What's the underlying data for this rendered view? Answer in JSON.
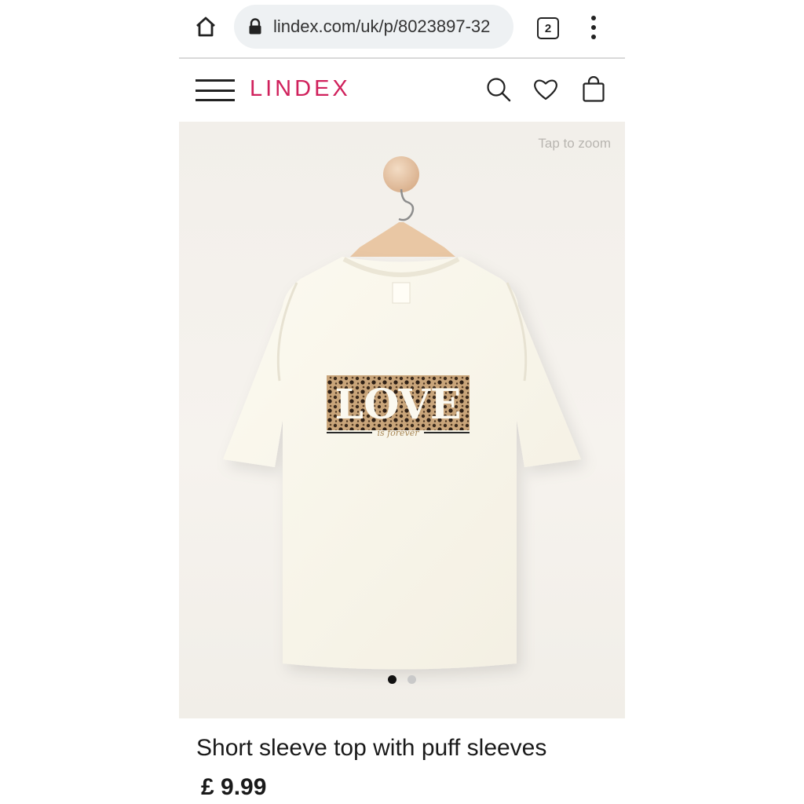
{
  "browser": {
    "url": "lindex.com/uk/p/8023897-32",
    "tab_count": "2",
    "icons": [
      "home-icon",
      "lock-icon",
      "tabs-icon",
      "more-vert-icon"
    ]
  },
  "header": {
    "logo": "LINDEX",
    "icons": [
      "menu-icon",
      "search-icon",
      "heart-icon",
      "bag-icon"
    ],
    "accent_color": "#d0215c"
  },
  "gallery": {
    "zoom_hint": "Tap to zoom",
    "print_text": "LOVE",
    "print_subtext": "is forever",
    "image_count": 2,
    "active_index": 0
  },
  "product": {
    "title": "Short sleeve top with puff sleeves",
    "price": "£ 9.99"
  }
}
